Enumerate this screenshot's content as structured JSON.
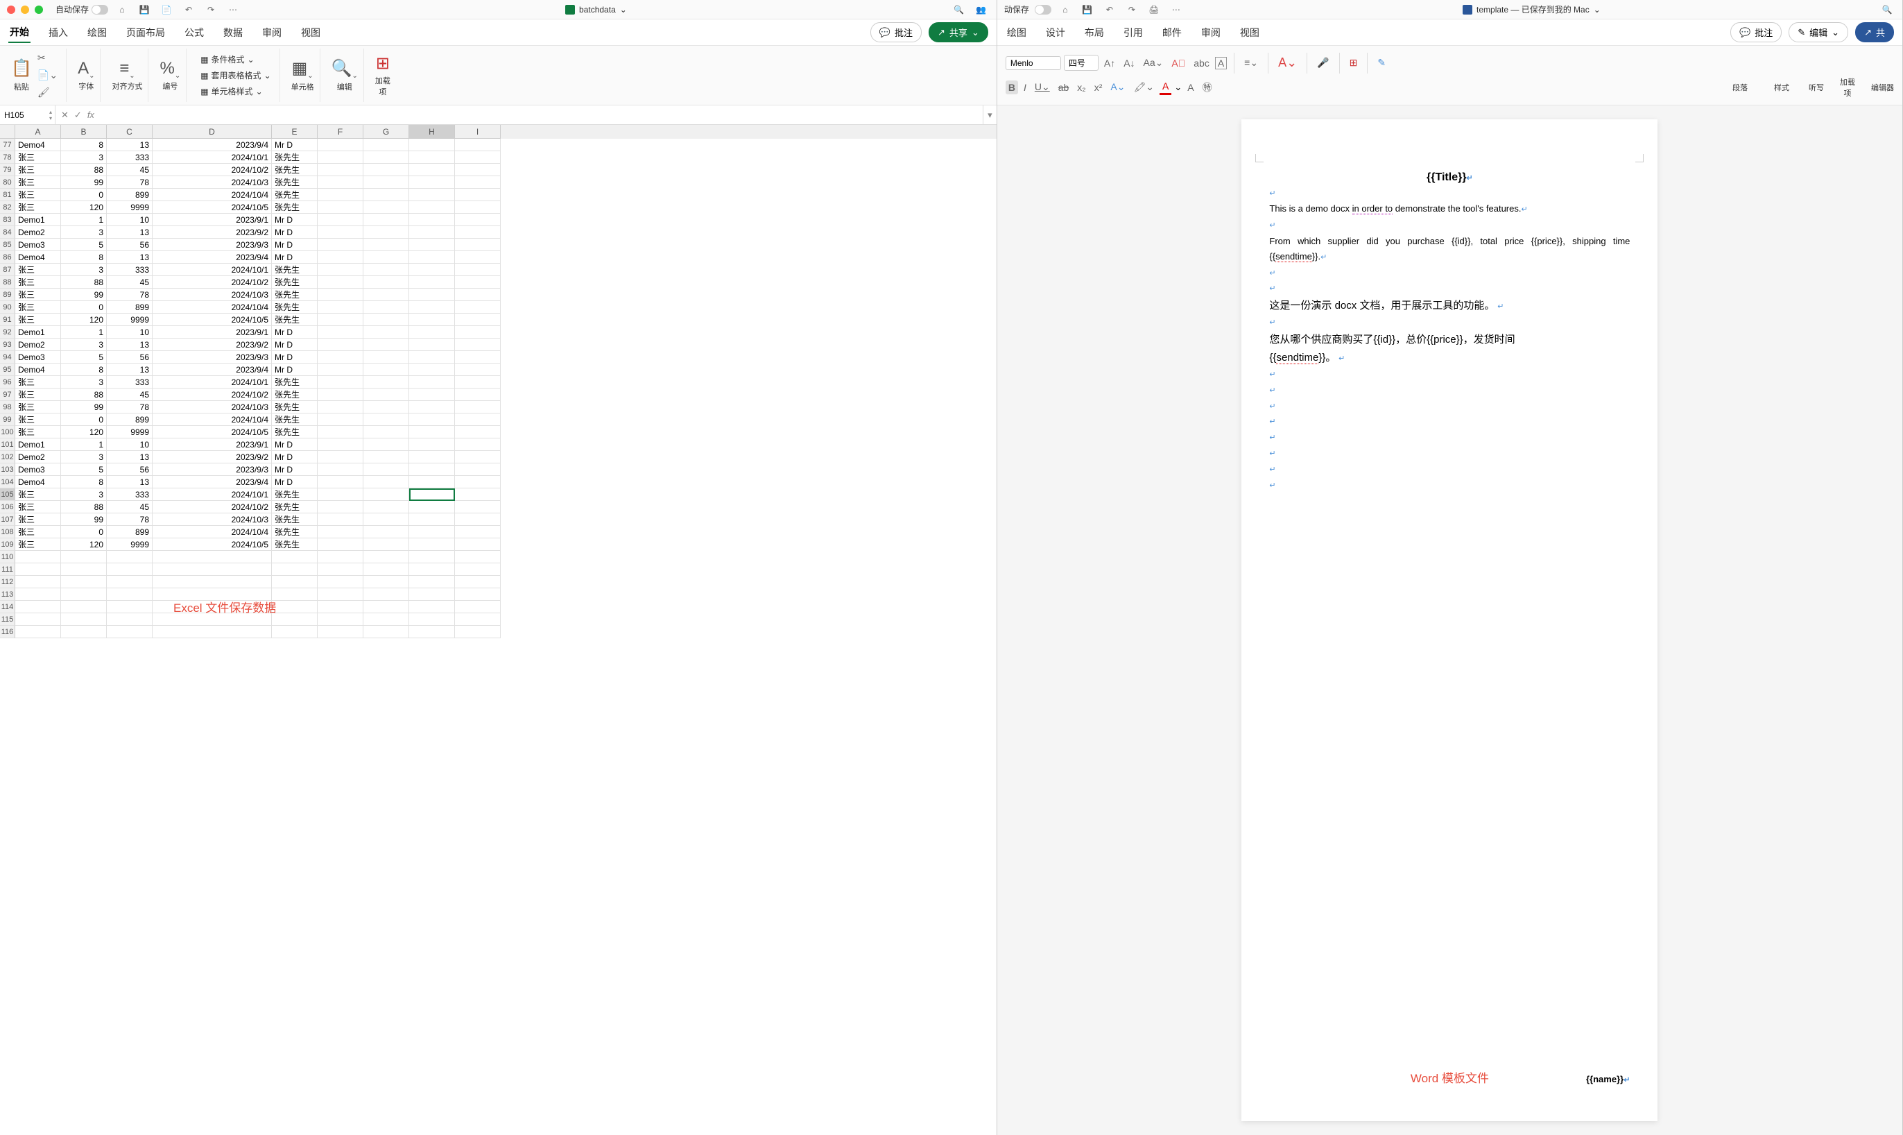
{
  "excel": {
    "autosaveLabel": "自动保存",
    "docName": "batchdata",
    "shareBtn": "共享",
    "commentBtn": "批注",
    "tabs": [
      "开始",
      "插入",
      "绘图",
      "页面布局",
      "公式",
      "数据",
      "审阅",
      "视图"
    ],
    "groups": {
      "paste": "粘贴",
      "font": "字体",
      "align": "对齐方式",
      "number": "编号",
      "cond": "条件格式",
      "tablefmt": "套用表格格式",
      "cellstyle": "单元格样式",
      "cells": "单元格",
      "editing": "编辑",
      "addins": "加载\n项"
    },
    "nameBox": "H105",
    "formula": "",
    "cols": [
      "A",
      "B",
      "C",
      "D",
      "E",
      "F",
      "G",
      "H",
      "I"
    ],
    "rows": [
      {
        "n": 77,
        "A": "Demo4",
        "B": 8,
        "C": 13,
        "D": "2023/9/4",
        "E": "Mr D"
      },
      {
        "n": 78,
        "A": "张三",
        "B": 3,
        "C": 333,
        "D": "2024/10/1",
        "E": "张先生"
      },
      {
        "n": 79,
        "A": "张三",
        "B": 88,
        "C": 45,
        "D": "2024/10/2",
        "E": "张先生"
      },
      {
        "n": 80,
        "A": "张三",
        "B": 99,
        "C": 78,
        "D": "2024/10/3",
        "E": "张先生"
      },
      {
        "n": 81,
        "A": "张三",
        "B": 0,
        "C": 899,
        "D": "2024/10/4",
        "E": "张先生"
      },
      {
        "n": 82,
        "A": "张三",
        "B": 120,
        "C": 9999,
        "D": "2024/10/5",
        "E": "张先生"
      },
      {
        "n": 83,
        "A": "Demo1",
        "B": 1,
        "C": 10,
        "D": "2023/9/1",
        "E": "Mr D"
      },
      {
        "n": 84,
        "A": "Demo2",
        "B": 3,
        "C": 13,
        "D": "2023/9/2",
        "E": "Mr D"
      },
      {
        "n": 85,
        "A": "Demo3",
        "B": 5,
        "C": 56,
        "D": "2023/9/3",
        "E": "Mr D"
      },
      {
        "n": 86,
        "A": "Demo4",
        "B": 8,
        "C": 13,
        "D": "2023/9/4",
        "E": "Mr D"
      },
      {
        "n": 87,
        "A": "张三",
        "B": 3,
        "C": 333,
        "D": "2024/10/1",
        "E": "张先生"
      },
      {
        "n": 88,
        "A": "张三",
        "B": 88,
        "C": 45,
        "D": "2024/10/2",
        "E": "张先生"
      },
      {
        "n": 89,
        "A": "张三",
        "B": 99,
        "C": 78,
        "D": "2024/10/3",
        "E": "张先生"
      },
      {
        "n": 90,
        "A": "张三",
        "B": 0,
        "C": 899,
        "D": "2024/10/4",
        "E": "张先生"
      },
      {
        "n": 91,
        "A": "张三",
        "B": 120,
        "C": 9999,
        "D": "2024/10/5",
        "E": "张先生"
      },
      {
        "n": 92,
        "A": "Demo1",
        "B": 1,
        "C": 10,
        "D": "2023/9/1",
        "E": "Mr D"
      },
      {
        "n": 93,
        "A": "Demo2",
        "B": 3,
        "C": 13,
        "D": "2023/9/2",
        "E": "Mr D"
      },
      {
        "n": 94,
        "A": "Demo3",
        "B": 5,
        "C": 56,
        "D": "2023/9/3",
        "E": "Mr D"
      },
      {
        "n": 95,
        "A": "Demo4",
        "B": 8,
        "C": 13,
        "D": "2023/9/4",
        "E": "Mr D"
      },
      {
        "n": 96,
        "A": "张三",
        "B": 3,
        "C": 333,
        "D": "2024/10/1",
        "E": "张先生"
      },
      {
        "n": 97,
        "A": "张三",
        "B": 88,
        "C": 45,
        "D": "2024/10/2",
        "E": "张先生"
      },
      {
        "n": 98,
        "A": "张三",
        "B": 99,
        "C": 78,
        "D": "2024/10/3",
        "E": "张先生"
      },
      {
        "n": 99,
        "A": "张三",
        "B": 0,
        "C": 899,
        "D": "2024/10/4",
        "E": "张先生"
      },
      {
        "n": 100,
        "A": "张三",
        "B": 120,
        "C": 9999,
        "D": "2024/10/5",
        "E": "张先生"
      },
      {
        "n": 101,
        "A": "Demo1",
        "B": 1,
        "C": 10,
        "D": "2023/9/1",
        "E": "Mr D"
      },
      {
        "n": 102,
        "A": "Demo2",
        "B": 3,
        "C": 13,
        "D": "2023/9/2",
        "E": "Mr D"
      },
      {
        "n": 103,
        "A": "Demo3",
        "B": 5,
        "C": 56,
        "D": "2023/9/3",
        "E": "Mr D"
      },
      {
        "n": 104,
        "A": "Demo4",
        "B": 8,
        "C": 13,
        "D": "2023/9/4",
        "E": "Mr D"
      },
      {
        "n": 105,
        "A": "张三",
        "B": 3,
        "C": 333,
        "D": "2024/10/1",
        "E": "张先生"
      },
      {
        "n": 106,
        "A": "张三",
        "B": 88,
        "C": 45,
        "D": "2024/10/2",
        "E": "张先生"
      },
      {
        "n": 107,
        "A": "张三",
        "B": 99,
        "C": 78,
        "D": "2024/10/3",
        "E": "张先生"
      },
      {
        "n": 108,
        "A": "张三",
        "B": 0,
        "C": 899,
        "D": "2024/10/4",
        "E": "张先生"
      },
      {
        "n": 109,
        "A": "张三",
        "B": 120,
        "C": 9999,
        "D": "2024/10/5",
        "E": "张先生"
      },
      {
        "n": 110
      },
      {
        "n": 111
      },
      {
        "n": 112
      },
      {
        "n": 113
      },
      {
        "n": 114
      },
      {
        "n": 115
      },
      {
        "n": 116
      }
    ],
    "caption": "Excel 文件保存数据",
    "selectedCell": "H105"
  },
  "word": {
    "autosaveLabel": "动保存",
    "docTitle": "template — 已保存到我的 Mac",
    "commentBtn": "批注",
    "editBtn": "编辑",
    "shareBtn": "共",
    "tabs": [
      "绘图",
      "设计",
      "布局",
      "引用",
      "邮件",
      "审阅",
      "视图"
    ],
    "font": "Menlo",
    "fontSize": "四号",
    "groups": {
      "paragraph": "段落",
      "styles": "样式",
      "dictate": "听写",
      "addins": "加载\n项",
      "editor": "编辑器"
    },
    "content": {
      "title": "{{Title}}",
      "p1_a": "This is a demo docx ",
      "p1_underline": "in order to",
      "p1_b": " demonstrate the tool's features.",
      "p2_a": "From which supplier did you purchase {{id}}, total price {{price}}, shipping time {{",
      "p2_wavy": "sendtime",
      "p2_b": "}}.",
      "cn1": "这是一份演示 docx 文档，用于展示工具的功能。",
      "cn2_a": "您从哪个供应商购买了{{id}}，总价{{price}}，发货时间",
      "cn2_b": "{{",
      "cn2_wavy": "sendtime",
      "cn2_c": "}}。",
      "name": "{{name}}"
    },
    "caption": "Word 模板文件"
  }
}
